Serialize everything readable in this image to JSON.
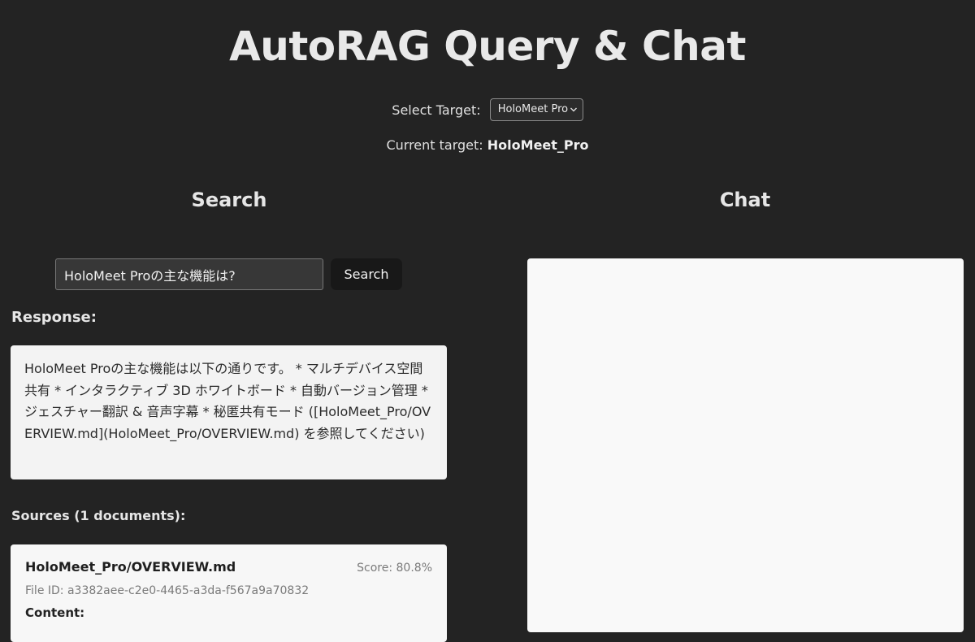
{
  "header": {
    "title": "AutoRAG Query & Chat"
  },
  "target": {
    "select_label": "Select Target:",
    "selected_option": "HoloMeet Pro",
    "current_prefix": "Current target:",
    "current_value": "HoloMeet_Pro"
  },
  "search": {
    "heading": "Search",
    "input_value": "HoloMeet Proの主な機能は?",
    "button_label": "Search",
    "response_label": "Response:",
    "response_text": "HoloMeet Proの主な機能は以下の通りです。 * マルチデバイス空間共有 * インタラクティブ 3D ホワイトボード * 自動バージョン管理 * ジェスチャー翻訳 & 音声字幕 * 秘匿共有モード ([HoloMeet_Pro/OVERVIEW.md](HoloMeet_Pro/OVERVIEW.md) を参照してください)",
    "sources_label": "Sources (1 documents):",
    "sources": [
      {
        "name": "HoloMeet_Pro/OVERVIEW.md",
        "score": "Score: 80.8%",
        "file_id": "File ID: a3382aee-c2e0-4465-a3da-f567a9a70832",
        "content_label": "Content:"
      }
    ]
  },
  "chat": {
    "heading": "Chat"
  },
  "icons": {
    "select_chevron": "chevron-down-icon"
  }
}
